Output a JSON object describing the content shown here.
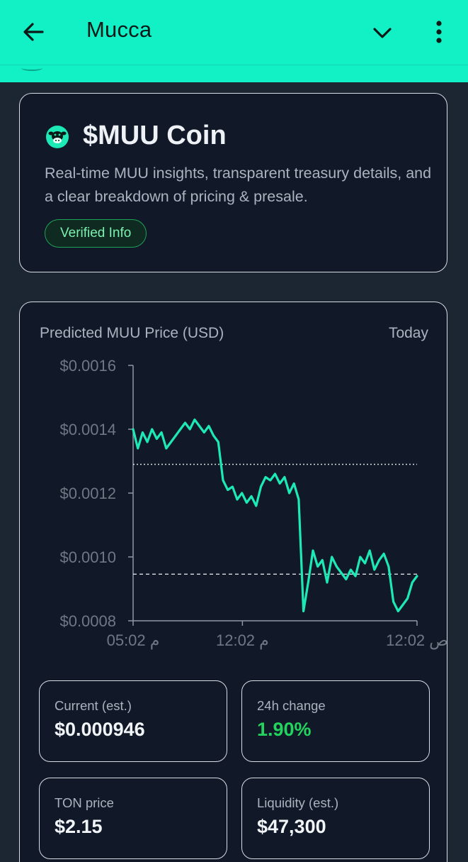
{
  "appbar": {
    "title": "Mucca"
  },
  "hero": {
    "title": "$MUU Coin",
    "description": "Real-time MUU insights, transparent treasury details, and a clear breakdown of pricing & presale.",
    "badge": "Verified Info"
  },
  "chart": {
    "title": "Predicted MUU Price (USD)",
    "range_label": "Today"
  },
  "chart_data": {
    "type": "line",
    "series_color": "#1de9b6",
    "ylim": [
      0.0008,
      0.0016
    ],
    "y_ticks": [
      "$0.0016",
      "$0.0014",
      "$0.0012",
      "$0.0010",
      "$0.0008"
    ],
    "y_tick_values": [
      0.0016,
      0.0014,
      0.0012,
      0.001,
      0.0008
    ],
    "x_ticks": [
      "05:02 م",
      "12:02 م",
      "12:02 ص"
    ],
    "x_tick_positions": [
      0.0,
      0.385,
      1.0
    ],
    "reference_lines": [
      {
        "value": 0.00129,
        "style": "dotted"
      },
      {
        "value": 0.000946,
        "style": "dashed"
      }
    ],
    "values": [
      0.0014,
      0.00134,
      0.00139,
      0.00136,
      0.0014,
      0.00137,
      0.00139,
      0.00134,
      0.00136,
      0.00138,
      0.0014,
      0.00142,
      0.0014,
      0.00143,
      0.00141,
      0.00139,
      0.00141,
      0.00138,
      0.00136,
      0.00124,
      0.00121,
      0.00122,
      0.00118,
      0.0012,
      0.00117,
      0.00119,
      0.00116,
      0.00122,
      0.00125,
      0.00124,
      0.00126,
      0.00123,
      0.00125,
      0.0012,
      0.00123,
      0.00118,
      0.00083,
      0.00092,
      0.00102,
      0.00097,
      0.00099,
      0.00092,
      0.001,
      0.00097,
      0.00095,
      0.00093,
      0.00096,
      0.00094,
      0.001,
      0.00098,
      0.00102,
      0.00096,
      0.00099,
      0.00101,
      0.00097,
      0.00086,
      0.00083,
      0.00085,
      0.00087,
      0.00092,
      0.00094
    ]
  },
  "stats": [
    {
      "label": "Current (est.)",
      "value": "$0.000946"
    },
    {
      "label": "24h change",
      "value": "1.90%"
    },
    {
      "label": "TON price",
      "value": "$2.15"
    },
    {
      "label": "Liquidity (est.)",
      "value": "$47,300"
    }
  ],
  "colors": {
    "appbar": "#12f0c6",
    "background": "#1c2532",
    "card": "#111827",
    "positive": "#22d35e",
    "badge_text": "#7cf0ae"
  },
  "icons": {
    "back": "back-arrow-icon",
    "dropdown": "chevron-down-icon",
    "menu": "more-vertical-icon",
    "coin": "cow-coin-icon"
  }
}
